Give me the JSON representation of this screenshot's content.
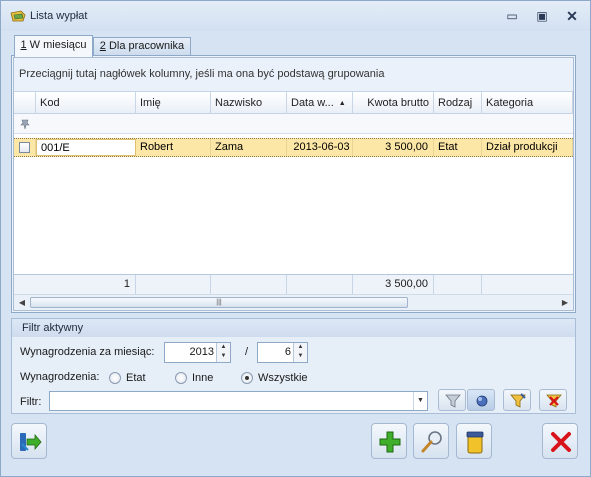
{
  "window": {
    "title": "Lista wypłat",
    "controls": {
      "minimize": "▭",
      "maximize": "▣",
      "close": "✕"
    }
  },
  "tabs": [
    {
      "key": "1",
      "label": " W miesiącu"
    },
    {
      "key": "2",
      "label": " Dla pracownika"
    }
  ],
  "grid": {
    "group_hint": "Przeciągnij tutaj nagłówek kolumny, jeśli ma ona być podstawą grupowania",
    "columns": [
      "Kod",
      "Imię",
      "Nazwisko",
      "Data w...",
      "Kwota brutto",
      "Rodzaj",
      "Kategoria"
    ],
    "rows": [
      {
        "kod": "001/E",
        "imie": "Robert",
        "nazwisko": "Zama",
        "data": "2013-06-03",
        "kwota": "3 500,00",
        "rodzaj": "Etat",
        "kategoria": "Dział produkcji"
      }
    ],
    "footer": {
      "count": "1",
      "sum": "3 500,00"
    },
    "scroll_grip": "|||"
  },
  "filter": {
    "title": "Filtr aktywny",
    "month_label": "Wynagrodzenia za miesiąc:",
    "year": "2013",
    "separator": "/",
    "month": "6",
    "type_label": "Wynagrodzenia:",
    "radio_options": [
      "Etat",
      "Inne",
      "Wszystkie"
    ],
    "radio_selected": "Wszystkie",
    "filter_label": "Filtr:",
    "filter_value": ""
  },
  "icons": {
    "app": "wallet-icon",
    "filter": "funnel-icon",
    "clear_filter": "funnel-clear-icon",
    "add": "plus-icon",
    "edit": "magnifier-icon",
    "delete": "trash-icon",
    "close": "red-x-icon",
    "export": "export-icon"
  },
  "colors": {
    "selected_row": "#fde7a6",
    "window_bg": "#d6e3f3",
    "add_green": "#3fae2a",
    "close_red": "#d8141a"
  }
}
